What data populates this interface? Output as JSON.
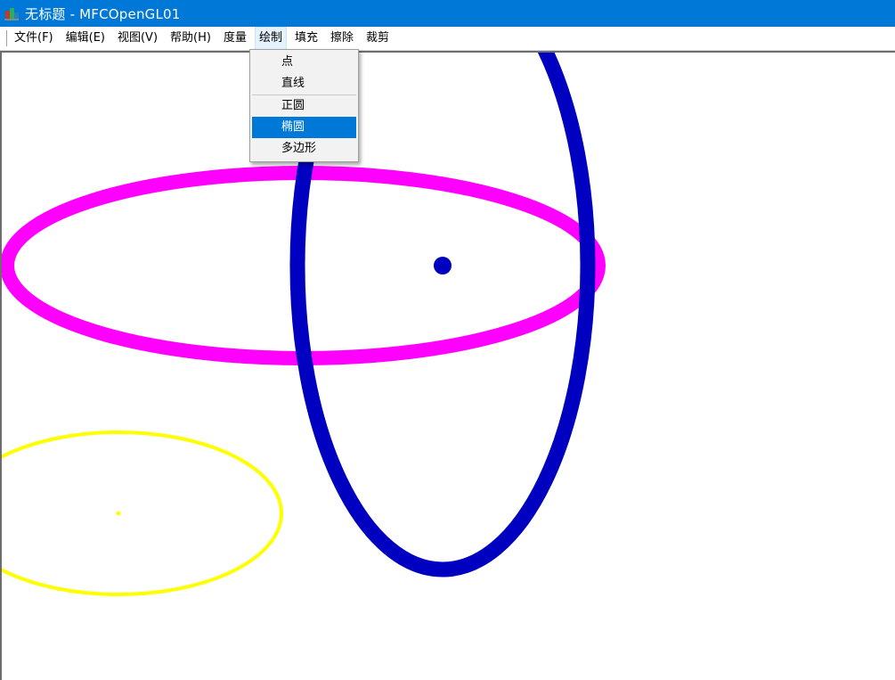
{
  "window": {
    "title": "无标题 - MFCOpenGL01",
    "icon": "mfc-app-icon"
  },
  "menubar": {
    "items": [
      {
        "label": "文件(F)"
      },
      {
        "label": "编辑(E)"
      },
      {
        "label": "视图(V)"
      },
      {
        "label": "帮助(H)"
      },
      {
        "label": "度量"
      },
      {
        "label": "绘制",
        "open": true
      },
      {
        "label": "填充"
      },
      {
        "label": "擦除"
      },
      {
        "label": "裁剪"
      }
    ]
  },
  "draw_menu": {
    "items": [
      {
        "label": "点"
      },
      {
        "label": "直线"
      },
      {
        "label": "正圆"
      },
      {
        "label": "椭圆",
        "selected": true
      },
      {
        "label": "多边形"
      }
    ]
  },
  "canvas": {
    "shapes": [
      {
        "type": "ellipse",
        "color": "#ff00ff",
        "stroke": "thick"
      },
      {
        "type": "ellipse",
        "color": "#0000c0",
        "stroke": "thick"
      },
      {
        "type": "point",
        "color": "#0000c0"
      },
      {
        "type": "ellipse",
        "color": "#ffff00",
        "stroke": "thin"
      },
      {
        "type": "point",
        "color": "#ffff00"
      }
    ]
  },
  "colors": {
    "titlebar": "#0078d7",
    "selection": "#0078d7"
  }
}
